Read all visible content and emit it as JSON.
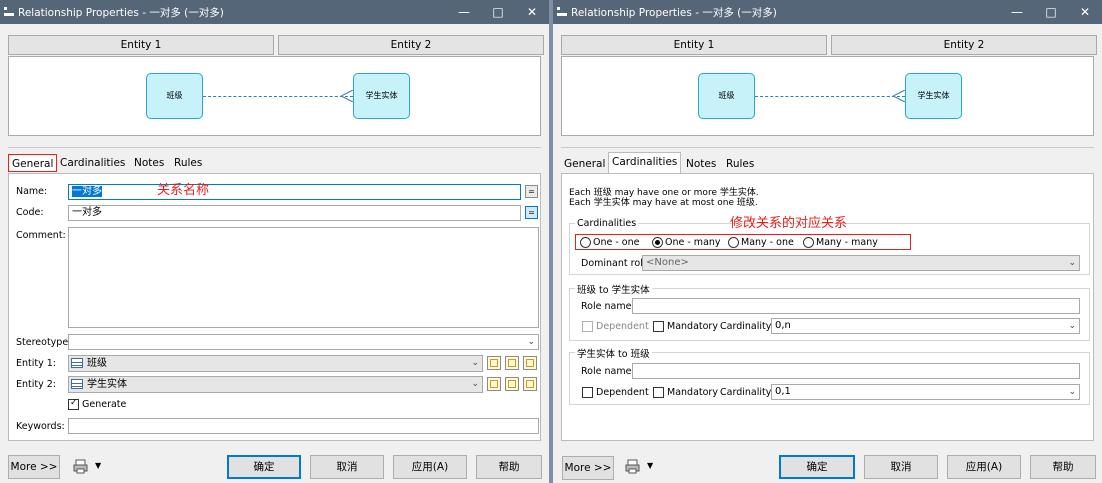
{
  "left_window": {
    "title": "Relationship Properties - 一对多 (一对多)",
    "entity_tabs": [
      "Entity 1",
      "Entity 2"
    ],
    "diagram": {
      "entity1": "班级",
      "entity2": "学生实体"
    },
    "tabs": [
      "General",
      "Cardinalities",
      "Notes",
      "Rules"
    ],
    "active_tab": "General",
    "fields": {
      "name_label": "Name:",
      "name_value": "一对多",
      "code_label": "Code:",
      "code_value": "一对多",
      "comment_label": "Comment:",
      "stereotype_label": "Stereotype:",
      "stereotype_value": "",
      "entity1_label": "Entity 1:",
      "entity1_value": "班级",
      "entity2_label": "Entity 2:",
      "entity2_value": "学生实体",
      "generate_label": "Generate",
      "generate_checked": true,
      "keywords_label": "Keywords:",
      "keywords_value": "",
      "eq_button": "="
    },
    "annotation": "关系名称",
    "footer": {
      "more": "More >>",
      "ok": "确定",
      "cancel": "取消",
      "apply": "应用(A)",
      "help": "帮助"
    }
  },
  "right_window": {
    "title": "Relationship Properties - 一对多 (一对多)",
    "entity_tabs": [
      "Entity 1",
      "Entity 2"
    ],
    "diagram": {
      "entity1": "班级",
      "entity2": "学生实体"
    },
    "tabs": [
      "General",
      "Cardinalities",
      "Notes",
      "Rules"
    ],
    "active_tab": "Cardinalities",
    "description": [
      "Each 班级 may have one or more 学生实体.",
      "Each 学生实体 may have at most one 班级."
    ],
    "cardinalities_group": "Cardinalities",
    "annotation": "修改关系的对应关系",
    "radios": [
      {
        "label": "One - one",
        "selected": false
      },
      {
        "label": "One - many",
        "selected": true
      },
      {
        "label": "Many - one",
        "selected": false
      },
      {
        "label": "Many - many",
        "selected": false
      }
    ],
    "dominant_role_label": "Dominant role:",
    "dominant_role_value": "<None>",
    "role1": {
      "title": "班级 to 学生实体",
      "role_name_label": "Role name:",
      "role_name_value": "",
      "dependent_label": "Dependent",
      "mandatory_label": "Mandatory",
      "cardinality_label": "Cardinality:",
      "cardinality_value": "0,n"
    },
    "role2": {
      "title": "学生实体 to 班级",
      "role_name_label": "Role name:",
      "role_name_value": "",
      "dependent_label": "Dependent",
      "mandatory_label": "Mandatory",
      "cardinality_label": "Cardinality:",
      "cardinality_value": "0,1"
    },
    "footer": {
      "more": "More >>",
      "ok": "确定",
      "cancel": "取消",
      "apply": "应用(A)",
      "help": "帮助"
    }
  },
  "colors": {
    "titlebar": "#566679",
    "entity_fill": "#c7f2fa",
    "annotation": "#e8201c",
    "default_button": "#0078d7"
  },
  "icons": [
    "window-icon",
    "minimize-icon",
    "maximize-icon",
    "close-icon",
    "table-icon",
    "properties-icon",
    "printer-icon",
    "chevron-down-icon"
  ]
}
